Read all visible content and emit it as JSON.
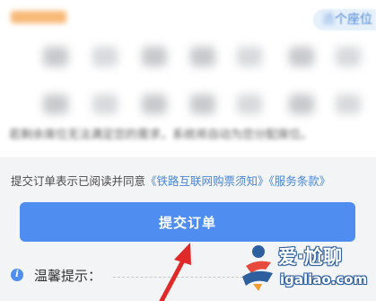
{
  "seat_panel": {
    "seat_link": "个座位",
    "seat_link_lead": "选",
    "note": "若剩余席位无法满足您的需求，系统将自动为您分配席位。"
  },
  "agreement": {
    "prefix": "提交订单表示已阅读并同意",
    "link_notice": "《铁路互联网购票须知》",
    "link_terms": "《服务条款》"
  },
  "submit_button": {
    "label": "提交订单"
  },
  "tips": {
    "label": "温馨提示："
  },
  "watermark": {
    "title": "爱·尬聊",
    "url": "igaliao.com"
  },
  "colors": {
    "primary": "#4f8ef0",
    "link": "#4a86d6",
    "annotation_arrow": "#e02a2a",
    "watermark_blue": "#2e5f9e"
  },
  "icons": [
    "info-icon",
    "annotation-arrow-icon",
    "watermark-logo-icon"
  ]
}
